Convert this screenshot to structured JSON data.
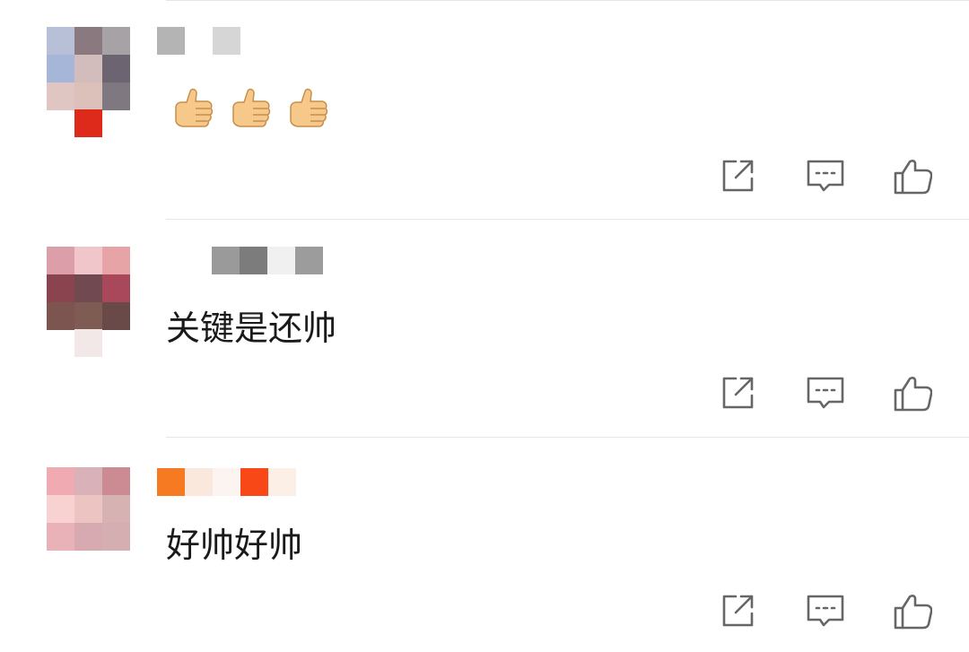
{
  "comments": [
    {
      "author": "",
      "text": "",
      "emoji": [
        "thumbs-up",
        "thumbs-up",
        "thumbs-up"
      ],
      "actions": [
        "share-icon",
        "reply-comment-icon",
        "like-icon"
      ]
    },
    {
      "author": "",
      "text": "关键是还帅",
      "actions": [
        "share-icon",
        "reply-comment-icon",
        "like-icon"
      ]
    },
    {
      "author": "",
      "text": "好帅好帅",
      "actions": [
        "share-icon",
        "reply-comment-icon",
        "like-icon"
      ]
    }
  ],
  "colors": {
    "text": "#1a1a1a",
    "icon": "#666666",
    "divider": "#e6e6e6",
    "emoji_skin": "#f6c98a"
  }
}
